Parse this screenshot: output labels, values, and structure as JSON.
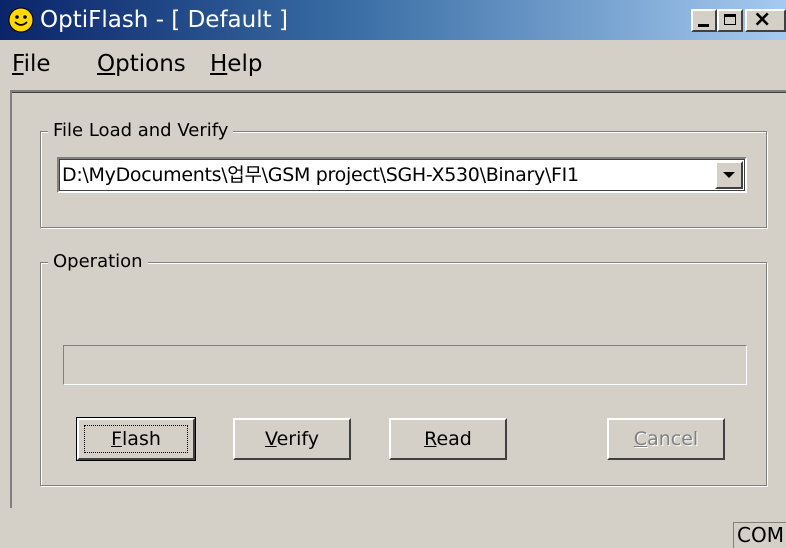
{
  "window": {
    "title": "OptiFlash - [ Default ]"
  },
  "title_icon": "smiley-face-icon",
  "caption_buttons": {
    "minimize": "minimize-icon",
    "maximize": "maximize-icon",
    "close": "close-icon"
  },
  "menu": {
    "file": {
      "first": "F",
      "rest": "ile"
    },
    "options": {
      "first": "O",
      "rest": "ptions"
    },
    "help": {
      "first": "H",
      "rest": "elp"
    }
  },
  "file_group": {
    "label": "File Load and Verify",
    "path_value": "D:\\MyDocuments\\업무\\GSM project\\SGH-X530\\Binary\\FI1"
  },
  "operation_group": {
    "label": "Operation",
    "progress": 0
  },
  "buttons": {
    "flash": {
      "first": "F",
      "rest": "lash"
    },
    "verify": {
      "first": "V",
      "rest": "erify"
    },
    "read": {
      "first": "R",
      "rest": "ead"
    },
    "cancel": {
      "first": "C",
      "rest": "ancel"
    }
  },
  "status": {
    "port": "COM"
  },
  "colors": {
    "face": "#d4d0c8",
    "title_start": "#0a246a",
    "title_end": "#a6caf0",
    "disabled_text": "#808080"
  }
}
